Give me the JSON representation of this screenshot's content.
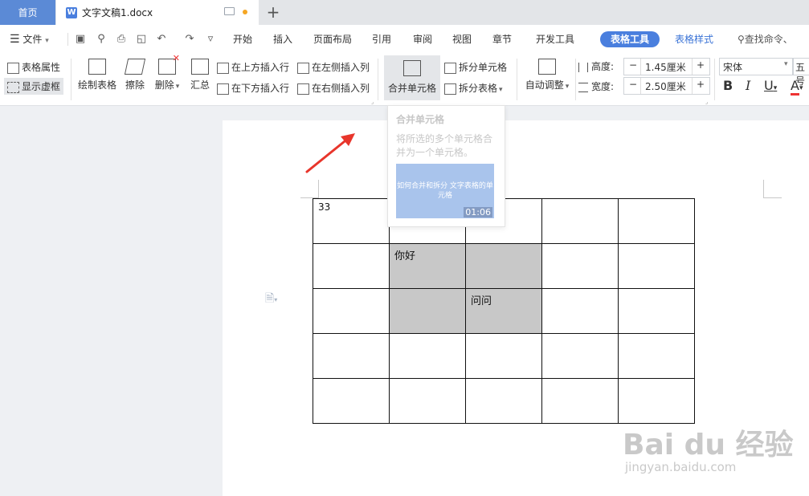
{
  "tabs": {
    "home": "首页",
    "doc_title": "文字文稿1.docx",
    "new_tab": "+"
  },
  "menu": {
    "file": "文件",
    "items": [
      "开始",
      "插入",
      "页面布局",
      "引用",
      "审阅",
      "视图",
      "章节",
      "开发工具"
    ],
    "active_context": "表格工具",
    "context2": "表格样式",
    "search": "查找命令、"
  },
  "ribbon": {
    "table_props": "表格属性",
    "show_gridlines": "显示虚框",
    "draw_table": "绘制表格",
    "eraser": "擦除",
    "delete": "删除",
    "summary": "汇总",
    "insert_row_above": "在上方插入行",
    "insert_row_below": "在下方插入行",
    "insert_col_left": "在左侧插入列",
    "insert_col_right": "在右侧插入列",
    "merge_cells": "合并单元格",
    "split_cells": "拆分单元格",
    "split_table": "拆分表格",
    "auto_fit": "自动调整",
    "height_label": "高度:",
    "height_value": "1.45厘米",
    "width_label": "宽度:",
    "width_value": "2.50厘米",
    "font_name": "宋体",
    "font_size": "五号",
    "minus": "−",
    "plus": "+"
  },
  "tooltip": {
    "title": "合并单元格",
    "description": "将所选的多个单元格合并为一个单元格。",
    "video_caption": "如何合并和拆分 文字表格的单元格",
    "duration": "01:06"
  },
  "table": {
    "rows": [
      [
        "33",
        "",
        "",
        "",
        ""
      ],
      [
        "",
        "你好",
        "",
        "",
        ""
      ],
      [
        "",
        "",
        "问问",
        "",
        ""
      ],
      [
        "",
        "",
        "",
        "",
        ""
      ],
      [
        "",
        "",
        "",
        "",
        ""
      ]
    ]
  },
  "watermark": {
    "brand": "Bai du 经验",
    "url": "jingyan.baidu.com"
  },
  "colors": {
    "accent": "#4a7fde",
    "home_tab": "#5b8ad6",
    "selection": "#c8c8c8",
    "arrow": "#e8352b"
  }
}
